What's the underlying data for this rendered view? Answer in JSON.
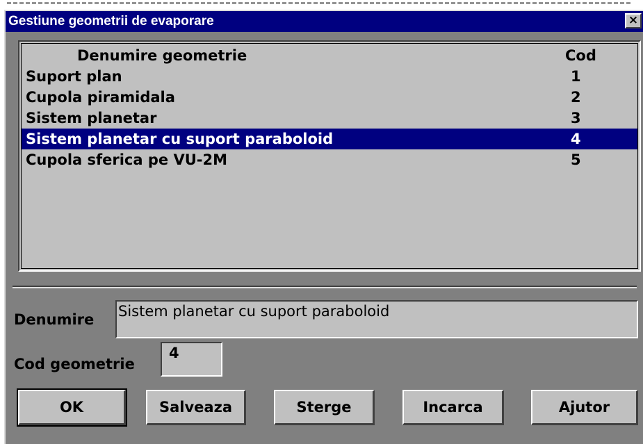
{
  "window": {
    "title": "Gestiune geometrii de evaporare",
    "close_label": "×"
  },
  "list": {
    "columns": {
      "name": "Denumire geometrie",
      "code": "Cod"
    },
    "rows": [
      {
        "name": "Suport plan",
        "code": "1"
      },
      {
        "name": "Cupola piramidala",
        "code": "2"
      },
      {
        "name": "Sistem planetar",
        "code": "3"
      },
      {
        "name": "Sistem planetar cu suport paraboloid",
        "code": "4"
      },
      {
        "name": "Cupola sferica pe VU-2M",
        "code": "5"
      }
    ],
    "selected_index": 3
  },
  "form": {
    "name_label": "Denumire",
    "name_value": "Sistem planetar cu suport paraboloid",
    "code_label": "Cod geometrie",
    "code_value": "4"
  },
  "buttons": {
    "ok": "OK",
    "save": "Salveaza",
    "delete": "Sterge",
    "load": "Incarca",
    "help": "Ajutor"
  },
  "colors": {
    "titlebar": "#000080",
    "selection": "#000080",
    "face": "#c0c0c0",
    "window_bg": "#808080"
  }
}
